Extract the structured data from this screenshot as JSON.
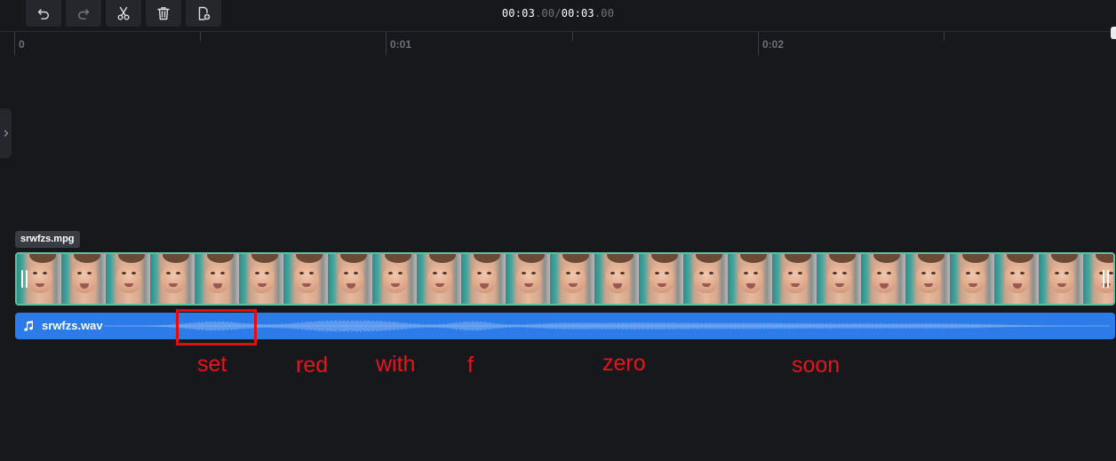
{
  "toolbar": {
    "buttons": [
      {
        "name": "undo-button",
        "icon": "undo-icon",
        "enabled": true
      },
      {
        "name": "redo-button",
        "icon": "redo-icon",
        "enabled": false
      },
      {
        "name": "cut-button",
        "icon": "scissors-icon",
        "enabled": true
      },
      {
        "name": "delete-button",
        "icon": "trash-icon",
        "enabled": true
      },
      {
        "name": "add-clip-button",
        "icon": "add-file-icon",
        "enabled": true
      }
    ],
    "current_time": "00:03",
    "current_time_ms": ".00",
    "separator": "/",
    "total_time": "00:03",
    "total_time_ms": ".00"
  },
  "ruler": {
    "labels": [
      "0",
      "0:01",
      "0:02"
    ]
  },
  "tracks": {
    "video": {
      "file_name": "srwfzs.mpg",
      "frame_count": 25
    },
    "audio": {
      "file_name": "srwfzs.wav",
      "icon": "music-note-icon"
    }
  },
  "annotations": {
    "words": [
      "set",
      "red",
      "with",
      "f",
      "zero",
      "soon"
    ],
    "color": "#e8141d"
  },
  "colors": {
    "background": "#17181c",
    "audio_track": "#2b7be9",
    "video_border": "#5ec2a0"
  }
}
